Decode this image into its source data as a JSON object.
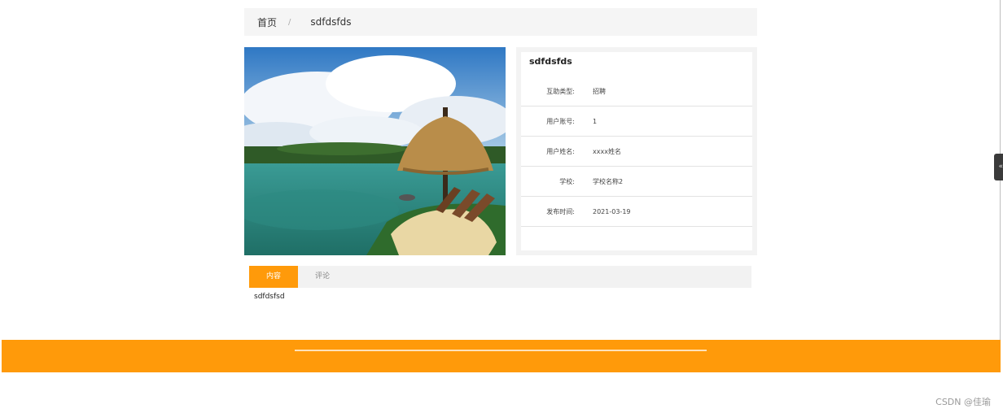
{
  "breadcrumb": {
    "home": "首页",
    "separator": "/",
    "current": "sdfdsfds"
  },
  "detail": {
    "title": "sdfdsfds",
    "fields": [
      {
        "label": "互助类型:",
        "value": "招聘"
      },
      {
        "label": "用户账号:",
        "value": "1"
      },
      {
        "label": "用户姓名:",
        "value": "xxxx姓名"
      },
      {
        "label": "学校:",
        "value": "学校名称2"
      },
      {
        "label": "发布时间:",
        "value": "2021-03-19"
      }
    ]
  },
  "tabs": [
    {
      "label": "内容",
      "active": true
    },
    {
      "label": "评论",
      "active": false
    }
  ],
  "content_text": "sdfdsfsd",
  "side_tab": {
    "glyph": "«"
  },
  "watermark": "CSDN @佳瑜",
  "colors": {
    "accent": "#ff9a0a",
    "panel": "#f5f5f5"
  }
}
